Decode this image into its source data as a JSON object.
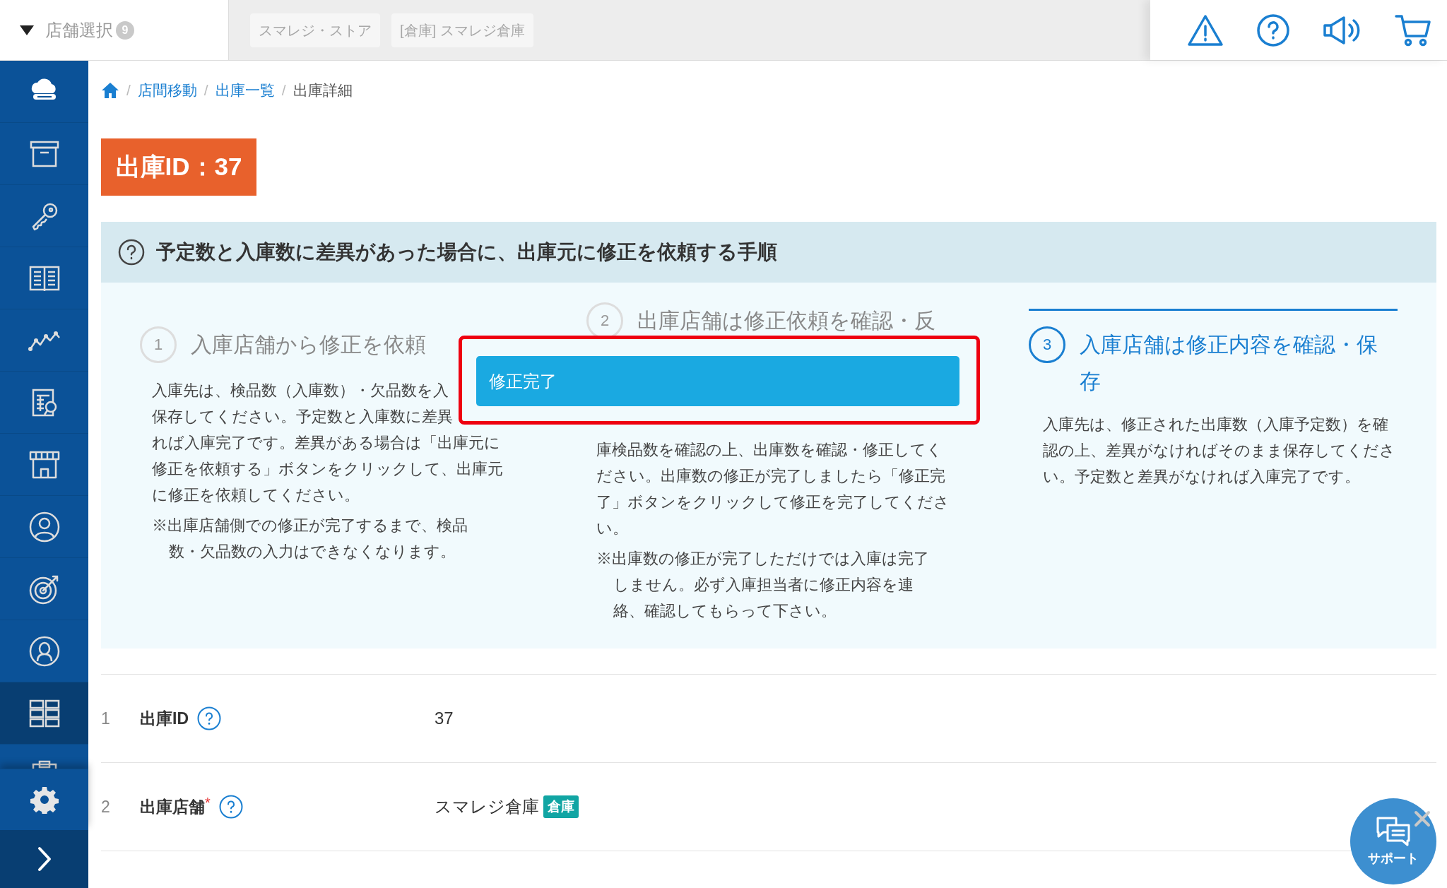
{
  "store_selector": {
    "label": "店舗選択",
    "badge": "9"
  },
  "store_chips": [
    "スマレジ・ストア",
    "[倉庫] スマレジ倉庫"
  ],
  "sidebar": {
    "items": [
      {
        "kind": "cloud",
        "selected": false
      },
      {
        "kind": "box",
        "selected": false
      },
      {
        "kind": "key",
        "selected": false
      },
      {
        "kind": "book",
        "selected": false
      },
      {
        "kind": "chart",
        "selected": false
      },
      {
        "kind": "report",
        "selected": false
      },
      {
        "kind": "store",
        "selected": false
      },
      {
        "kind": "person",
        "selected": false
      },
      {
        "kind": "target",
        "selected": false
      },
      {
        "kind": "user",
        "selected": false
      },
      {
        "kind": "grid",
        "selected": true
      },
      {
        "kind": "clipboard",
        "selected": false
      }
    ]
  },
  "breadcrumb": [
    {
      "separator": "/",
      "label": "店間移動",
      "link": true
    },
    {
      "separator": "/",
      "label": "出庫一覧",
      "link": true
    },
    {
      "separator": "/",
      "label": "出庫詳細",
      "link": false
    }
  ],
  "title": "出庫ID：37",
  "guide": {
    "heading": "予定数と入庫数に差異があった場合に、出庫元に修正を依頼する手順",
    "steps": [
      {
        "number": "1",
        "title": "入庫店舗から修正を依頼",
        "active": false,
        "lines": [
          "入庫先は、検品数（入庫数）・欠品数を入",
          "保存してください。予定数と入庫数に差異",
          "れば入庫完了です。差異がある場合は「出庫元に",
          "修正を依頼する」ボタンをクリックして、出庫元",
          "に修正を依頼してください。"
        ],
        "notes": [
          "※出庫店舗側での修正が完了するまで、検品",
          "数・欠品数の入力はできなくなります。"
        ]
      },
      {
        "number": "2",
        "title": "出庫店舗は修正依頼を確認・反",
        "active": false,
        "lines": [
          "庫検品数を確認の上、出庫数を確認・修正してく",
          "ださい。出庫数の修正が完了しましたら「修正完",
          "了」ボタンをクリックして修正を完了してくださ",
          "い。"
        ],
        "notes": [
          "※出庫数の修正が完了しただけでは入庫は完了",
          "しません。必ず入庫担当者に修正内容を連",
          "絡、確認してもらって下さい。"
        ]
      },
      {
        "number": "3",
        "title": "入庫店舗は修正内容を確認・保存",
        "active": true,
        "lines": [
          "入庫先は、修正された出庫数（入庫予定数）を確",
          "認の上、差異がなければそのまま保存してくださ",
          "い。予定数と差異がなければ入庫完了です。"
        ]
      }
    ]
  },
  "annotation": {
    "button_label": "修正完了"
  },
  "rows": [
    {
      "number": "1",
      "label": "出庫ID",
      "value": "37"
    },
    {
      "number": "2",
      "label": "出庫店舗",
      "required_mark": "*",
      "value": "スマレジ倉庫",
      "tag": "倉庫"
    }
  ],
  "support": {
    "label": "サポート"
  }
}
